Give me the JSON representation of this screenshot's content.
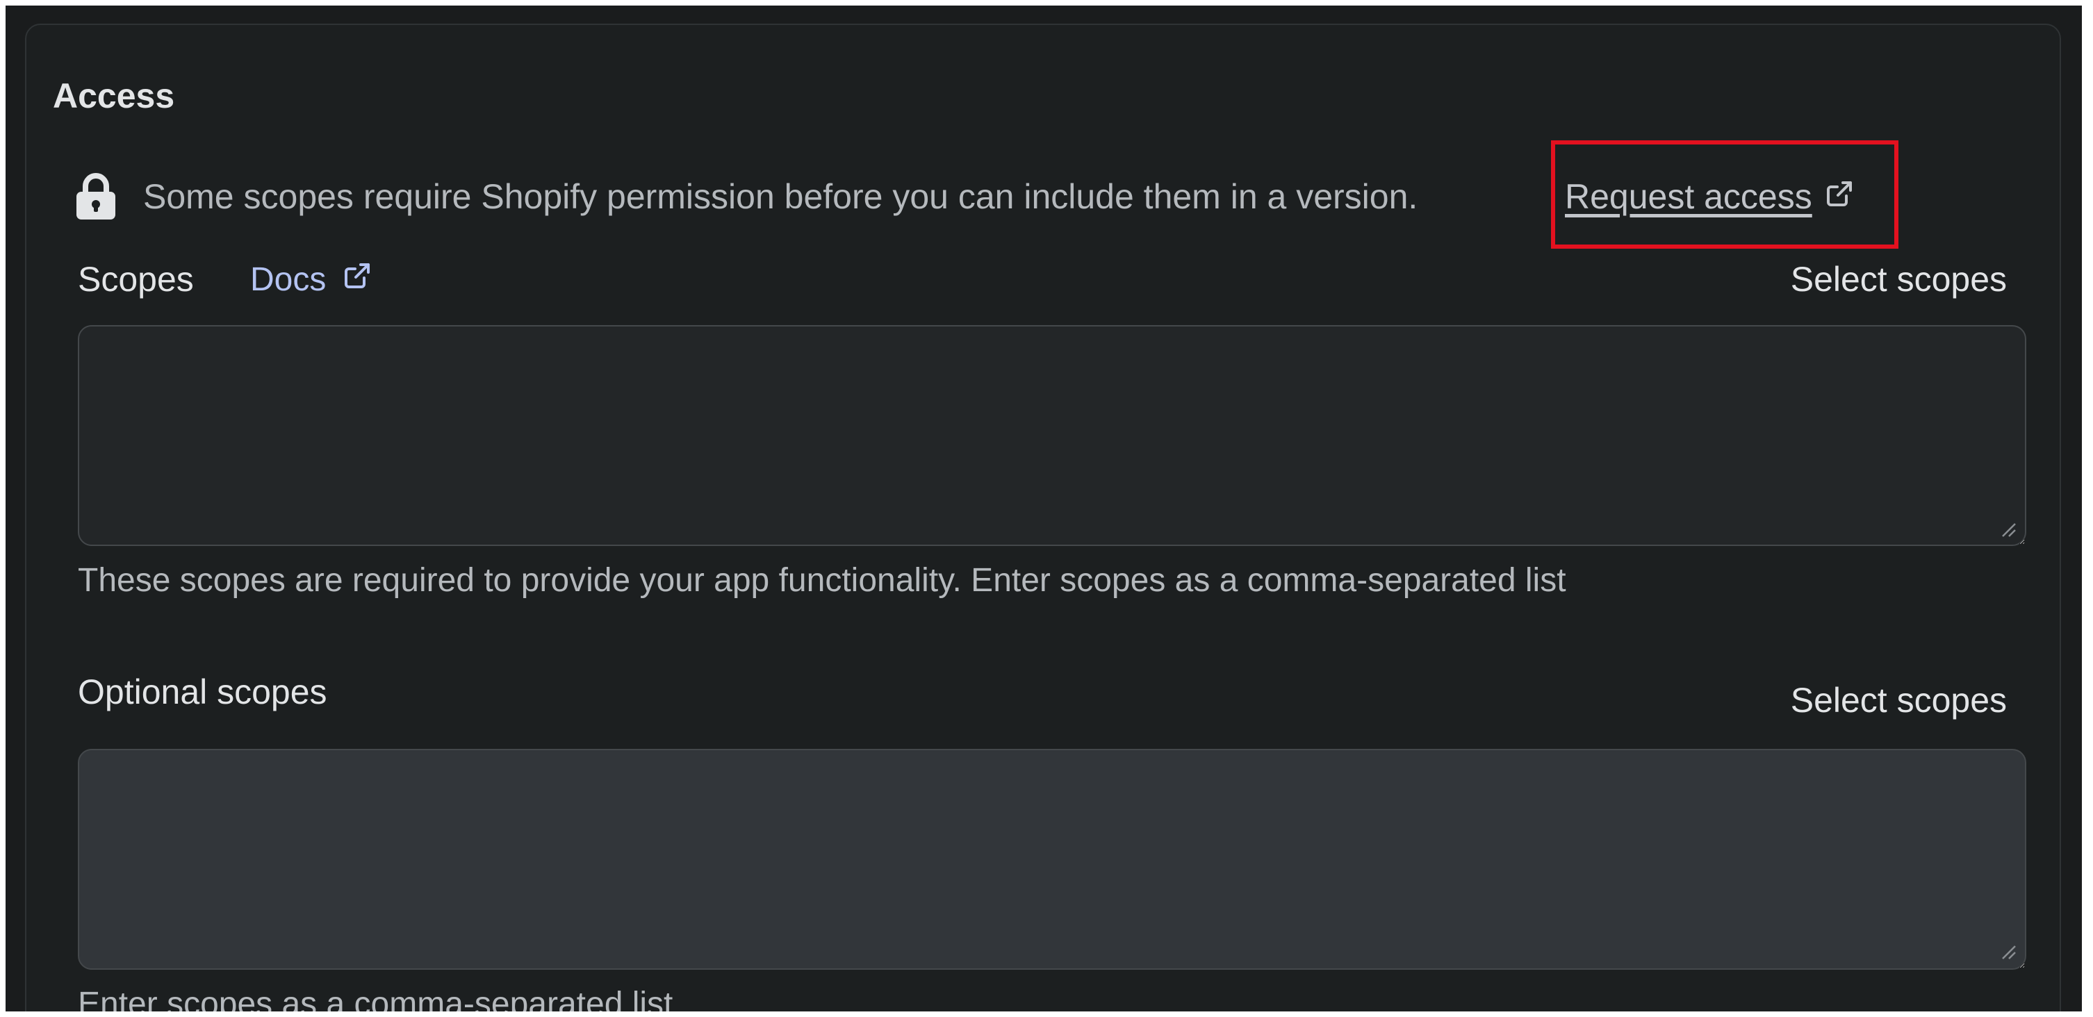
{
  "section": {
    "title": "Access"
  },
  "notice": {
    "icon": "lock-icon",
    "text": "Some scopes require Shopify permission before you can include them in a version.",
    "link_label": "Request access",
    "link_icon": "external-link-icon"
  },
  "scopes": {
    "label": "Scopes",
    "docs_label": "Docs",
    "docs_icon": "external-link-icon",
    "select_label": "Select scopes",
    "value": "",
    "help": "These scopes are required to provide your app functionality. Enter scopes as a comma-separated list"
  },
  "optional_scopes": {
    "label": "Optional scopes",
    "select_label": "Select scopes",
    "value": "",
    "help": "Enter scopes as a comma-separated list"
  },
  "colors": {
    "page_background": "#1a1c1d",
    "card_background": "#1c1f20",
    "highlight_border": "#e3111f",
    "docs_link": "#b4c3f2"
  }
}
